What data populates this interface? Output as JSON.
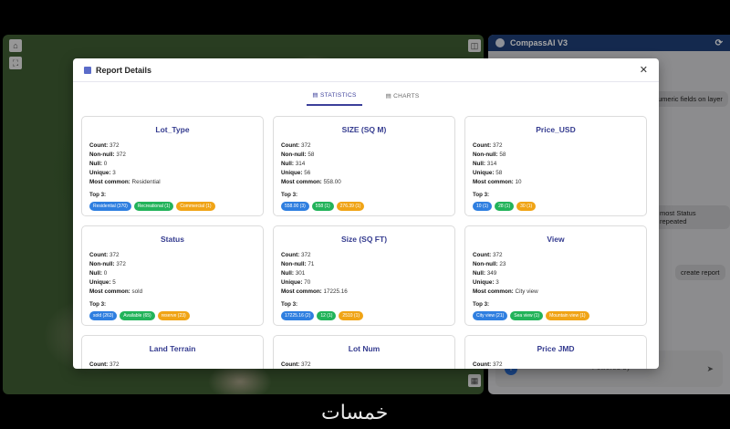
{
  "chat": {
    "title": "CompassAI V3",
    "bubbles": [
      "umeric fields on layer",
      "most Status repeated",
      "create report"
    ],
    "powered": "Powered by"
  },
  "modal": {
    "title": "Report Details",
    "tabs": [
      "STATISTICS",
      "CHARTS"
    ],
    "labels": {
      "count": "Count:",
      "nonnull": "Non-null:",
      "null": "Null:",
      "unique": "Unique:",
      "common": "Most common:",
      "top3": "Top 3:"
    },
    "cards": [
      {
        "title": "Lot_Type",
        "count": "372",
        "nonnull": "372",
        "null": "0",
        "unique": "3",
        "common": "Residential",
        "chips": [
          "Residential (370)",
          "Recreational (1)",
          "Commercial (1)"
        ]
      },
      {
        "title": "SIZE (SQ M)",
        "count": "372",
        "nonnull": "58",
        "null": "314",
        "unique": "56",
        "common": "558.00",
        "chips": [
          "558.00 (3)",
          "558 (1)",
          "276.39 (1)"
        ]
      },
      {
        "title": "Price_USD",
        "count": "372",
        "nonnull": "58",
        "null": "314",
        "unique": "58",
        "common": "10",
        "chips": [
          "10 (1)",
          "28 (1)",
          "30 (1)"
        ]
      },
      {
        "title": "Status",
        "count": "372",
        "nonnull": "372",
        "null": "0",
        "unique": "5",
        "common": "sold",
        "chips": [
          "sold (263)",
          "Available (65)",
          "reserve (23)"
        ]
      },
      {
        "title": "Size (SQ FT)",
        "count": "372",
        "nonnull": "71",
        "null": "301",
        "unique": "70",
        "common": "17225.16",
        "chips": [
          "17225.16 (2)",
          "12 (1)",
          "2510 (1)"
        ]
      },
      {
        "title": "View",
        "count": "372",
        "nonnull": "23",
        "null": "349",
        "unique": "3",
        "common": "City view",
        "chips": [
          "City view (21)",
          "Sea view (1)",
          "Mountain view (1)"
        ]
      },
      {
        "title": "Land Terrain",
        "count": "372"
      },
      {
        "title": "Lot Num",
        "count": "372"
      },
      {
        "title": "Price JMD",
        "count": "372"
      }
    ]
  },
  "watermark": "خمسات"
}
